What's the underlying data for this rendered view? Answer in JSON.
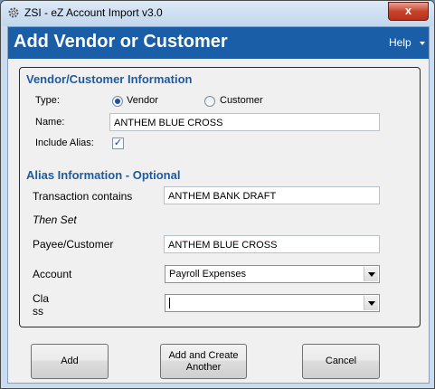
{
  "window": {
    "title": "ZSI - eZ Account Import v3.0",
    "close_glyph": "x"
  },
  "header": {
    "title": "Add Vendor or Customer",
    "help_label": "Help"
  },
  "vendor_section": {
    "title": "Vendor/Customer Information",
    "type_label": "Type:",
    "type_options": [
      "Vendor",
      "Customer"
    ],
    "type_selected": "Vendor",
    "name_label": "Name:",
    "name_value": "ANTHEM BLUE CROSS",
    "include_alias_label": "Include Alias:",
    "include_alias_checked": true,
    "check_glyph": "✓"
  },
  "alias_section": {
    "title": "Alias Information - Optional",
    "transaction_label": "Transaction contains",
    "transaction_value": "ANTHEM BANK DRAFT",
    "then_set_label": "Then Set",
    "payee_label": "Payee/Customer",
    "payee_value": "ANTHEM BLUE CROSS",
    "account_label": "Account",
    "account_value": "Payroll Expenses",
    "class_label_line1": "Cla",
    "class_label_line2": "ss",
    "class_value": ""
  },
  "buttons": {
    "add": "Add",
    "add_create_line1": "Add and Create",
    "add_create_line2": "Another",
    "cancel": "Cancel"
  },
  "colors": {
    "header_bg": "#1a5ea8",
    "section_title": "#1f5b9c",
    "close_button": "#c9432c"
  }
}
